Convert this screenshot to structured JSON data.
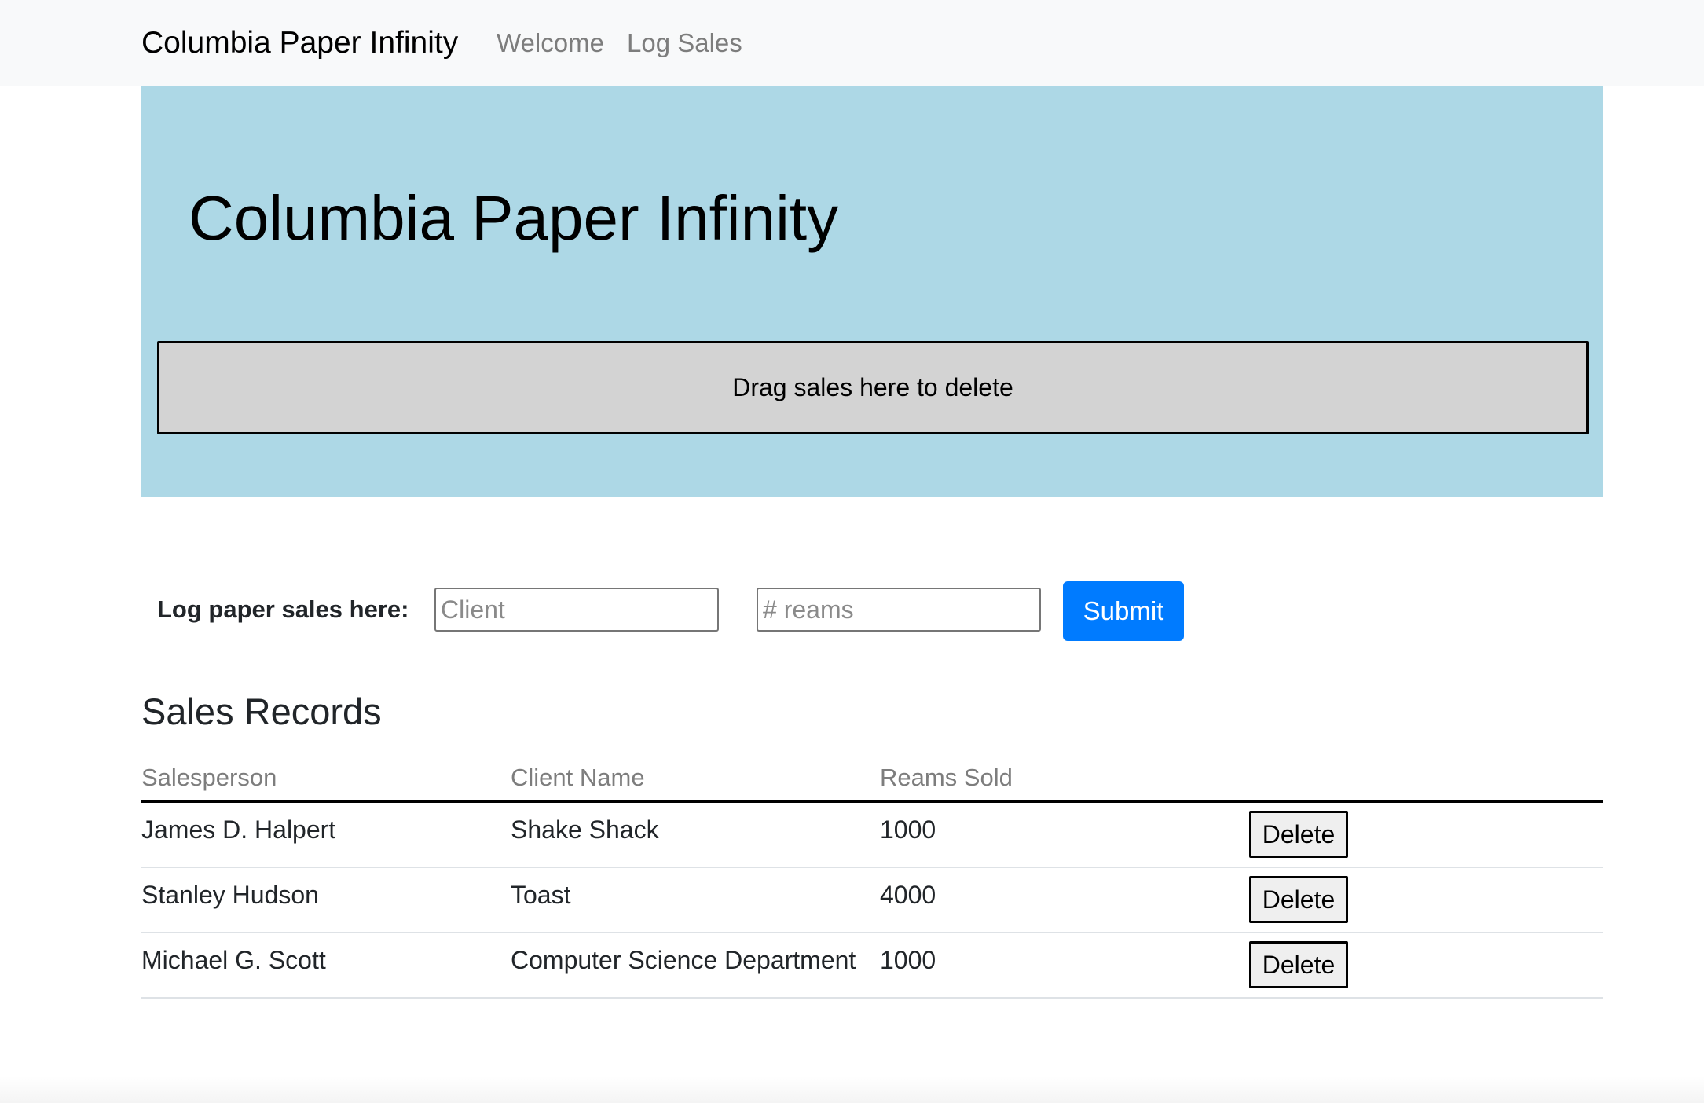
{
  "nav": {
    "brand": "Columbia Paper Infinity",
    "links": [
      "Welcome",
      "Log Sales"
    ]
  },
  "jumbotron": {
    "title": "Columbia Paper Infinity",
    "dropzone_text": "Drag sales here to delete"
  },
  "form": {
    "label": "Log paper sales here:",
    "client_placeholder": "Client",
    "reams_placeholder": "# reams",
    "submit_label": "Submit"
  },
  "sales": {
    "title": "Sales Records",
    "columns": [
      "Salesperson",
      "Client Name",
      "Reams Sold"
    ],
    "rows": [
      {
        "salesperson": "James D. Halpert",
        "client": "Shake Shack",
        "reams": "1000",
        "action": "Delete"
      },
      {
        "salesperson": "Stanley Hudson",
        "client": "Toast",
        "reams": "4000",
        "action": "Delete"
      },
      {
        "salesperson": "Michael G. Scott",
        "client": "Computer Science Department",
        "reams": "1000",
        "action": "Delete"
      }
    ]
  },
  "colors": {
    "navbar_bg": "#f8f9fa",
    "jumbotron_bg": "#add8e6",
    "dropzone_bg": "#d3d3d3",
    "submit_bg": "#007bff"
  }
}
